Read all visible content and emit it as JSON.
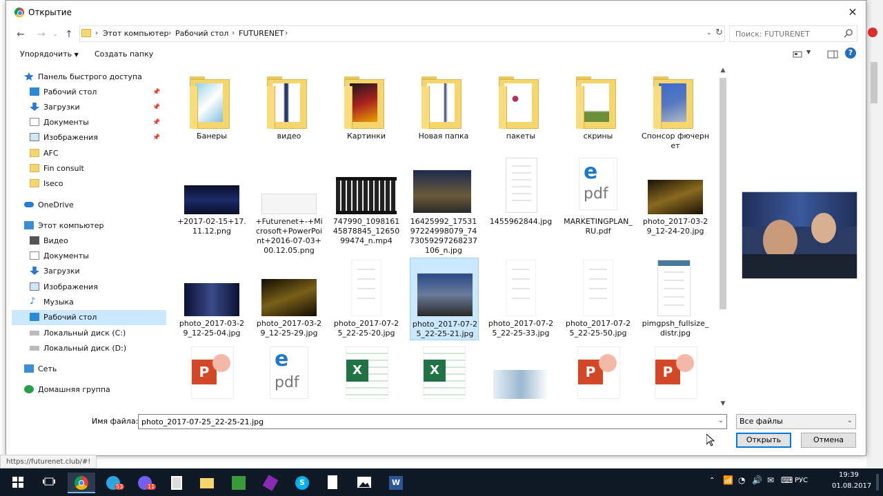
{
  "dialog": {
    "title": "Открытие",
    "close": "✕"
  },
  "address": {
    "breadcrumbs": [
      "Этот компьютер",
      "Рабочий стол",
      "FUTURENET"
    ],
    "search_placeholder": "Поиск: FUTURENET"
  },
  "toolbar": {
    "organize": "Упорядочить",
    "new_folder": "Создать папку"
  },
  "nav": {
    "quick_access": "Панель быстрого доступа",
    "quick_items": [
      "Рабочий стол",
      "Загрузки",
      "Документы",
      "Изображения",
      "AFC",
      "Fin consult",
      "Iseco"
    ],
    "onedrive": "OneDrive",
    "this_pc": "Этот компьютер",
    "pc_items": [
      "Видео",
      "Документы",
      "Загрузки",
      "Изображения",
      "Музыка",
      "Рабочий стол",
      "Локальный диск (C:)",
      "Локальный диск (D:)"
    ],
    "network": "Сеть",
    "homegroup": "Домашняя группа"
  },
  "files": {
    "row1": [
      "Банеры",
      "видео",
      "Картинки",
      "Новая папка",
      "пакеты",
      "скрины",
      "Спонсор фючернет"
    ],
    "row2": [
      "+2017-02-15+17.11.12.png",
      "+Futurenet+-+Microsoft+PowerPoint+2016-07-03+00.12.05.png",
      "747990_109816145878845_1265099474_n.mp4",
      "16425992_1753197224998079_7473059297268237106_n.jpg",
      "1455962844.jpg",
      "MARKETINGPLAN_RU.pdf",
      "photo_2017-03-29_12-24-20.jpg"
    ],
    "row3": [
      "photo_2017-03-29_12-25-04.jpg",
      "photo_2017-03-29_12-25-29.jpg",
      "photo_2017-07-25_22-25-20.jpg",
      "photo_2017-07-25_22-25-21.jpg",
      "photo_2017-07-25_22-25-33.jpg",
      "photo_2017-07-25_22-25-50.jpg",
      "pimgpsh_fullsize_distr.jpg"
    ],
    "pdf_text": "pdf"
  },
  "bottom": {
    "filename_label": "Имя файла:",
    "filename_value": "photo_2017-07-25_22-25-21.jpg",
    "filetype": "Все файлы",
    "open": "Открыть",
    "cancel": "Отмена"
  },
  "status_url": "https://futurenet.club/#!",
  "taskbar": {
    "lang": "РУС",
    "time": "19:39",
    "date": "01.08.2017",
    "badge_1": "53",
    "badge_2": "11"
  },
  "colors": {
    "selection": "#cce8ff",
    "folder": "#f5d66e",
    "accent": "#0078d7",
    "taskbar": "#101a26"
  }
}
